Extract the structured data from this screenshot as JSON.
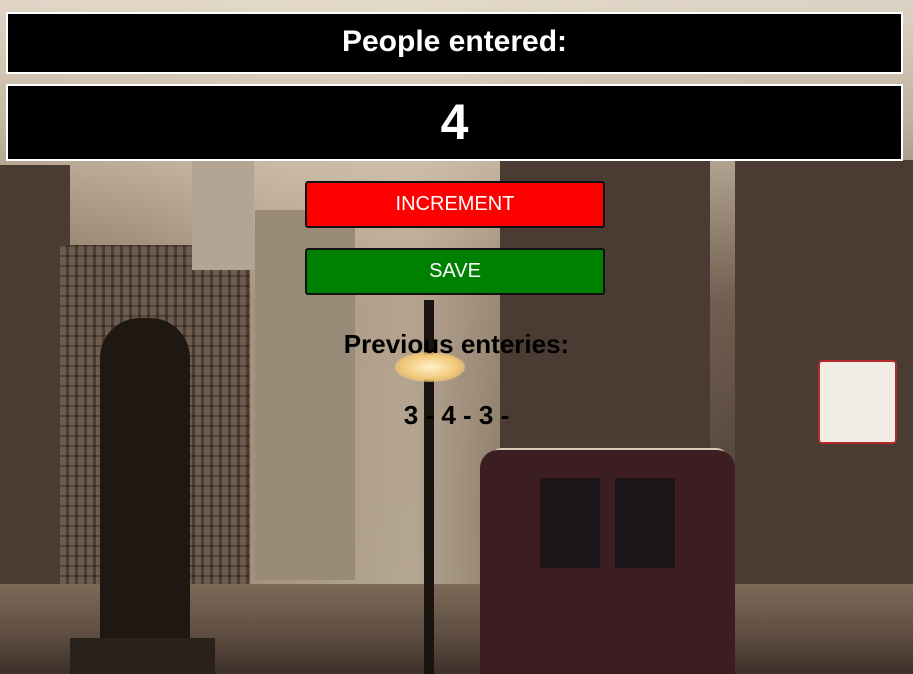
{
  "counter": {
    "title": "People entered:",
    "count": "4"
  },
  "buttons": {
    "increment_label": "INCREMENT",
    "save_label": "SAVE"
  },
  "previous": {
    "title": "Previous enteries:",
    "entries_text": "3 - 4 - 3 -"
  },
  "colors": {
    "increment": "#ff0000",
    "save": "#008000"
  }
}
